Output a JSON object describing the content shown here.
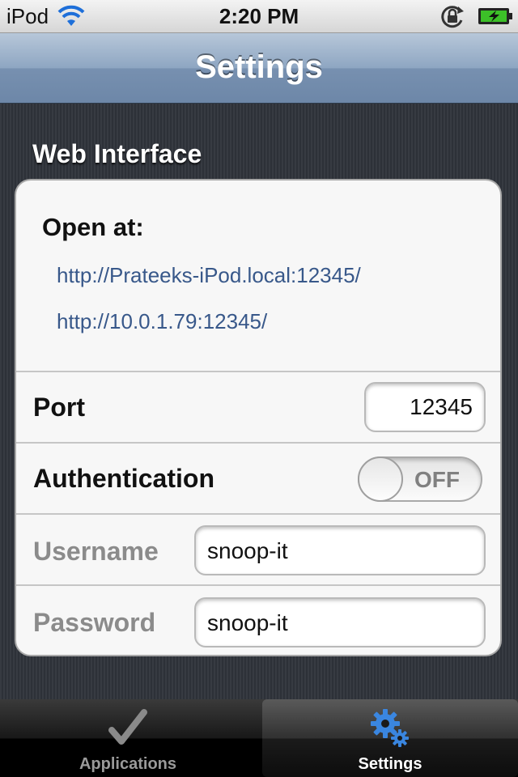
{
  "status_bar": {
    "carrier": "iPod",
    "time": "2:20 PM",
    "icons": [
      "wifi-icon",
      "rotation-lock-icon",
      "battery-charging-icon"
    ],
    "battery_color": "#3cc028"
  },
  "nav": {
    "title": "Settings"
  },
  "section": {
    "header": "Web Interface",
    "open_at_label": "Open at:",
    "urls": [
      "http://Prateeks-iPod.local:12345/",
      "http://10.0.1.79:12345/"
    ],
    "url_color": "#38588a"
  },
  "port": {
    "label": "Port",
    "value": "12345"
  },
  "authentication": {
    "label": "Authentication",
    "toggle_text": "OFF",
    "enabled": false
  },
  "username": {
    "label": "Username",
    "value": "snoop-it"
  },
  "password": {
    "label": "Password",
    "value": "snoop-it"
  },
  "tabbar": {
    "tabs": [
      {
        "label": "Applications",
        "icon": "checkmark-icon",
        "selected": false
      },
      {
        "label": "Settings",
        "icon": "gears-icon",
        "selected": true
      }
    ]
  }
}
